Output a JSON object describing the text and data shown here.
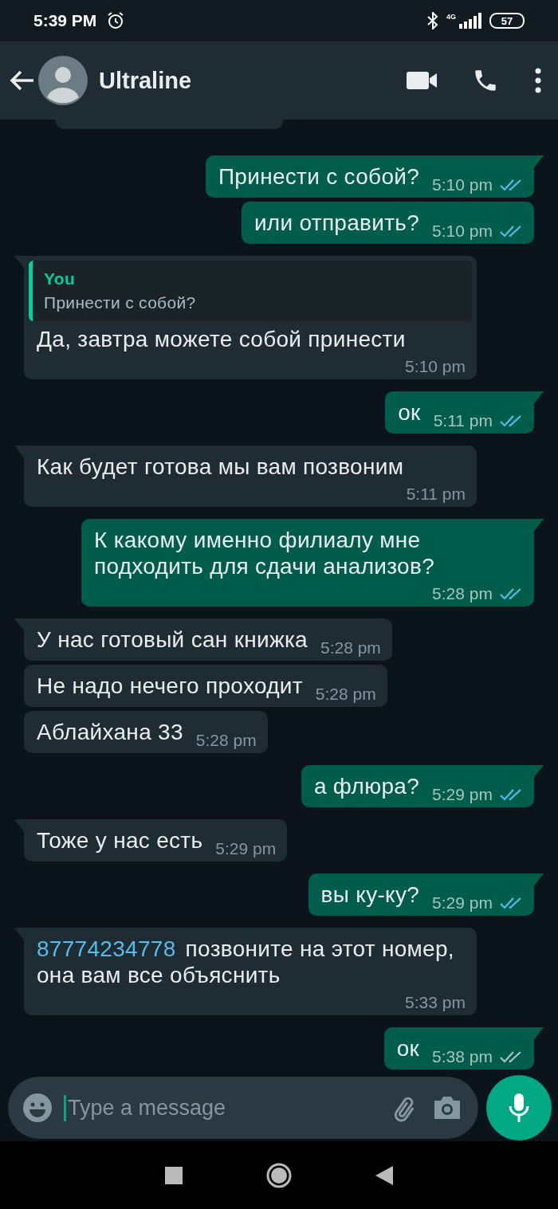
{
  "status_bar": {
    "time": "5:39 PM",
    "network": "4G",
    "battery": "57"
  },
  "header": {
    "title": "Ultraline"
  },
  "messages": [
    {
      "kind": "sent",
      "tail": true,
      "text": "Принести с собой?",
      "time": "5:10 pm",
      "read": true
    },
    {
      "kind": "sent",
      "tail": false,
      "text": "или отправить?",
      "time": "5:10 pm",
      "read": true
    },
    {
      "kind": "received",
      "tail": true,
      "quote": {
        "author": "You",
        "text": "Принести с собой?"
      },
      "text": "Да, завтра можете собой принести",
      "time": "5:10 pm"
    },
    {
      "kind": "sent",
      "tail": true,
      "text": "ок",
      "time": "5:11 pm",
      "read": true
    },
    {
      "kind": "received",
      "tail": true,
      "text": "Как будет готова мы вам позвоним",
      "time": "5:11 pm"
    },
    {
      "kind": "sent",
      "tail": true,
      "text": "К какому именно филиалу мне подходить для сдачи анализов?",
      "time": "5:28 pm",
      "read": true
    },
    {
      "kind": "received",
      "tail": true,
      "text": "У нас готовый сан книжка",
      "time": "5:28 pm"
    },
    {
      "kind": "received",
      "tail": false,
      "text": "Не надо нечего проходит",
      "time": "5:28 pm"
    },
    {
      "kind": "received",
      "tail": false,
      "text": "Аблайхана 33",
      "time": "5:28 pm"
    },
    {
      "kind": "sent",
      "tail": true,
      "text": "а флюра?",
      "time": "5:29 pm",
      "read": true
    },
    {
      "kind": "received",
      "tail": true,
      "text": "Тоже у нас есть",
      "time": "5:29 pm"
    },
    {
      "kind": "sent",
      "tail": true,
      "text": "вы ку-ку?",
      "time": "5:29 pm",
      "read": true
    },
    {
      "kind": "received",
      "tail": true,
      "link": "87774234778",
      "text": "позвоните на этот номер, она вам все объяснить",
      "time": "5:33 pm"
    },
    {
      "kind": "sent",
      "tail": true,
      "text": "ок",
      "time": "5:38 pm",
      "read": false
    }
  ],
  "composer": {
    "placeholder": "Type a message"
  }
}
